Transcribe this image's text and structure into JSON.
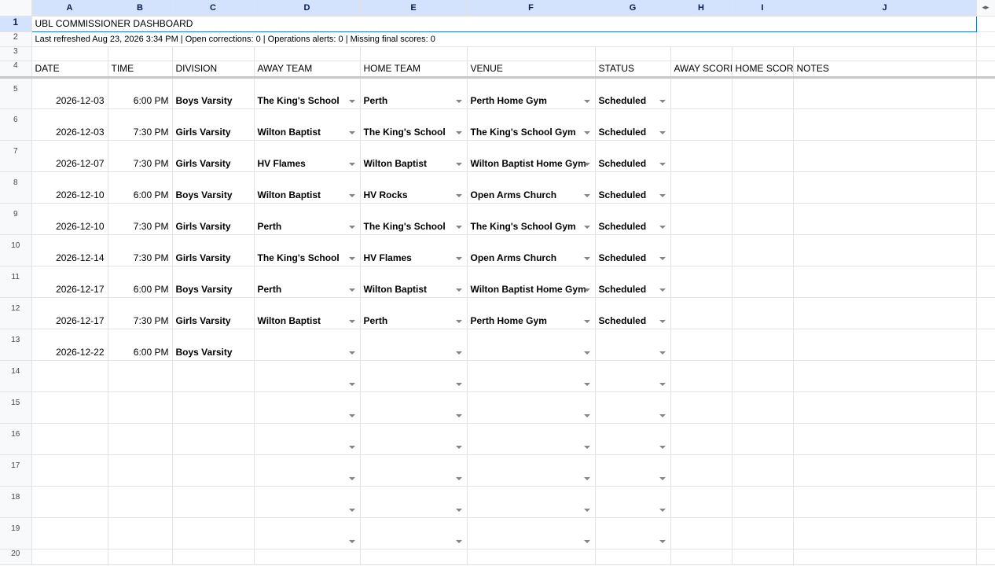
{
  "columns": [
    "A",
    "B",
    "C",
    "D",
    "E",
    "F",
    "G",
    "H",
    "I",
    "J"
  ],
  "title": "UBL COMMISSIONER DASHBOARD",
  "subtitle": "Last refreshed Aug 23, 2026 3:34 PM | Open corrections: 0 | Operations alerts: 0 | Missing final scores: 0",
  "headers": [
    "DATE",
    "TIME",
    "DIVISION",
    "AWAY TEAM",
    "HOME TEAM",
    "VENUE",
    "STATUS",
    "AWAY SCORE",
    "HOME SCORE",
    "NOTES"
  ],
  "row_numbers": [
    "1",
    "2",
    "3",
    "4",
    "5",
    "6",
    "7",
    "8",
    "9",
    "10",
    "11",
    "12",
    "13",
    "14",
    "15",
    "16",
    "17",
    "18",
    "19",
    "20"
  ],
  "games": [
    {
      "date": "2026-12-03",
      "time": "6:00 PM",
      "division": "Boys Varsity",
      "away": "The King's School",
      "home": "Perth",
      "venue": "Perth Home Gym",
      "status": "Scheduled"
    },
    {
      "date": "2026-12-03",
      "time": "7:30 PM",
      "division": "Girls Varsity",
      "away": "Wilton Baptist",
      "home": "The King's School",
      "venue": "The King's School Gym",
      "status": "Scheduled"
    },
    {
      "date": "2026-12-07",
      "time": "7:30 PM",
      "division": "Girls Varsity",
      "away": "HV Flames",
      "home": "Wilton Baptist",
      "venue": "Wilton Baptist Home Gym",
      "status": "Scheduled"
    },
    {
      "date": "2026-12-10",
      "time": "6:00 PM",
      "division": "Boys Varsity",
      "away": "Wilton Baptist",
      "home": "HV Rocks",
      "venue": "Open Arms Church",
      "status": "Scheduled"
    },
    {
      "date": "2026-12-10",
      "time": "7:30 PM",
      "division": "Girls Varsity",
      "away": "Perth",
      "home": "The King's School",
      "venue": "The King's School Gym",
      "status": "Scheduled"
    },
    {
      "date": "2026-12-14",
      "time": "7:30 PM",
      "division": "Girls Varsity",
      "away": "The King's School",
      "home": "HV Flames",
      "venue": "Open Arms Church",
      "status": "Scheduled"
    },
    {
      "date": "2026-12-17",
      "time": "6:00 PM",
      "division": "Boys Varsity",
      "away": "Perth",
      "home": "Wilton Baptist",
      "venue": "Wilton Baptist Home Gym",
      "status": "Scheduled"
    },
    {
      "date": "2026-12-17",
      "time": "7:30 PM",
      "division": "Girls Varsity",
      "away": "Wilton Baptist",
      "home": "Perth",
      "venue": "Perth Home Gym",
      "status": "Scheduled"
    },
    {
      "date": "2026-12-22",
      "time": "6:00 PM",
      "division": "Boys Varsity",
      "away": "",
      "home": "",
      "venue": "",
      "status": ""
    },
    {
      "date": "",
      "time": "",
      "division": "",
      "away": "",
      "home": "",
      "venue": "",
      "status": ""
    },
    {
      "date": "",
      "time": "",
      "division": "",
      "away": "",
      "home": "",
      "venue": "",
      "status": ""
    },
    {
      "date": "",
      "time": "",
      "division": "",
      "away": "",
      "home": "",
      "venue": "",
      "status": ""
    },
    {
      "date": "",
      "time": "",
      "division": "",
      "away": "",
      "home": "",
      "venue": "",
      "status": ""
    },
    {
      "date": "",
      "time": "",
      "division": "",
      "away": "",
      "home": "",
      "venue": "",
      "status": ""
    },
    {
      "date": "",
      "time": "",
      "division": "",
      "away": "",
      "home": "",
      "venue": "",
      "status": ""
    }
  ],
  "icons": {
    "dropdown": "dropdown-arrow-icon",
    "scroll_left": "chevron-left-icon",
    "scroll_right": "chevron-right-icon"
  },
  "colors": {
    "selection": "#d3e3fd",
    "active_border": "#1a73e8",
    "header_bg": "#f8f9fa"
  }
}
